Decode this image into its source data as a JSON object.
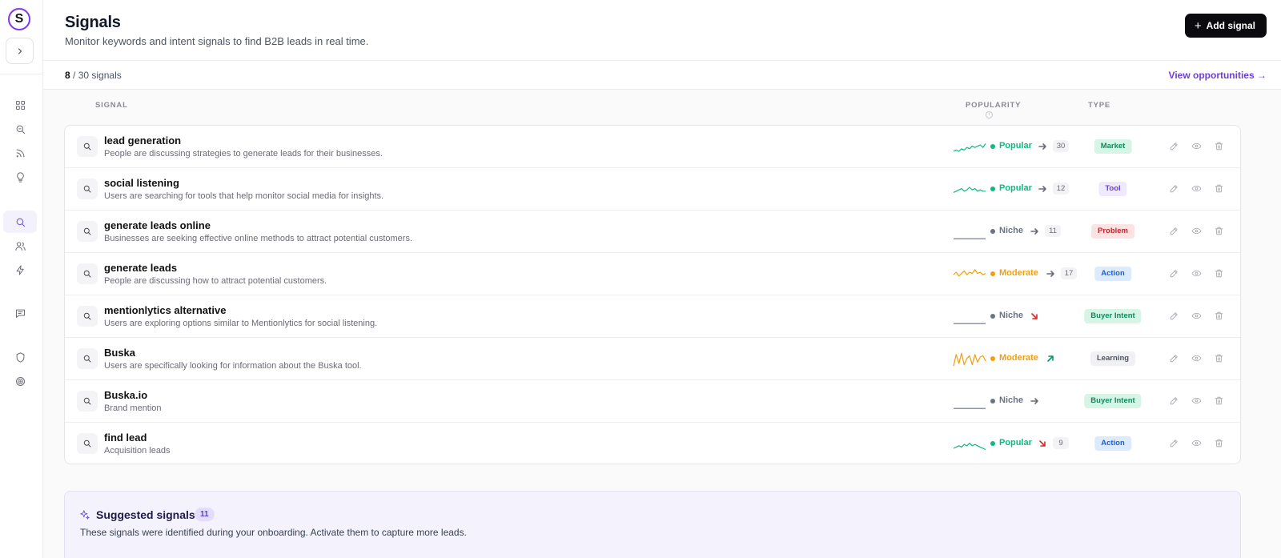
{
  "app": {
    "logo_letter": "S"
  },
  "header": {
    "title": "Signals",
    "subtitle": "Monitor keywords and intent signals to find B2B leads in real time.",
    "add_button": "Add signal"
  },
  "summary": {
    "active": "8",
    "total_text": "/ 30 signals",
    "view_link": "View opportunities →"
  },
  "columns": {
    "signal": "SIGNAL",
    "popularity": "POPULARITY",
    "popularity_info": "i",
    "type": "TYPE"
  },
  "colors": {
    "accent": "#6d3fd6",
    "popular": "#10b981",
    "moderate": "#f59e0b",
    "niche": "#6b7280",
    "trend_down": "#dc2626",
    "trend_up": "#059669"
  },
  "signals": [
    {
      "title": "lead generation",
      "description": "People are discussing strategies to generate leads for their businesses.",
      "popularity": "Popular",
      "trend": "flat",
      "count": "30",
      "type": "Market",
      "spark": [
        10,
        9,
        10,
        8,
        9,
        7,
        8,
        6,
        7,
        6,
        5,
        7,
        4
      ]
    },
    {
      "title": "social listening",
      "description": "Users are searching for tools that help monitor social media for insights.",
      "popularity": "Popular",
      "trend": "flat",
      "count": "12",
      "type": "Tool",
      "spark": [
        9,
        8,
        7,
        6,
        8,
        7,
        5,
        7,
        6,
        8,
        7,
        8,
        8
      ]
    },
    {
      "title": "generate leads online",
      "description": "Businesses are seeking effective online methods to attract potential customers.",
      "popularity": "Niche",
      "trend": "flat",
      "count": "11",
      "type": "Problem",
      "spark": [
        12,
        12,
        12,
        12,
        12,
        12,
        12,
        12,
        12,
        12,
        12,
        12,
        12
      ]
    },
    {
      "title": "generate leads",
      "description": "People are discussing how to attract potential customers.",
      "popularity": "Moderate",
      "trend": "flat",
      "count": "17",
      "type": "Action",
      "spark": [
        7,
        5,
        8,
        6,
        4,
        7,
        5,
        6,
        3,
        6,
        5,
        7,
        6
      ]
    },
    {
      "title": "mentionlytics alternative",
      "description": "Users are exploring options similar to Mentionlytics for social listening.",
      "popularity": "Niche",
      "trend": "down",
      "count": "",
      "type": "Buyer Intent",
      "spark": [
        12,
        12,
        12,
        12,
        12,
        12,
        12,
        12,
        12,
        12,
        12,
        12,
        12
      ]
    },
    {
      "title": "Buska",
      "description": "Users are specifically looking for information about the Buska tool.",
      "popularity": "Moderate",
      "trend": "up",
      "count": "",
      "type": "Learning",
      "spark": [
        12,
        3,
        10,
        2,
        11,
        6,
        4,
        11,
        3,
        9,
        5,
        4,
        8
      ]
    },
    {
      "title": "Buska.io",
      "description": "Brand mention",
      "popularity": "Niche",
      "trend": "flat",
      "count": "",
      "type": "Buyer Intent",
      "spark": [
        12,
        12,
        12,
        12,
        12,
        12,
        12,
        12,
        12,
        12,
        12,
        12,
        12
      ]
    },
    {
      "title": "find lead",
      "description": "Acquisition leads",
      "popularity": "Popular",
      "trend": "down",
      "count": "9",
      "type": "Action",
      "spark": [
        10,
        9,
        8,
        9,
        7,
        8,
        6,
        8,
        7,
        8,
        9,
        10,
        11
      ]
    }
  ],
  "type_styles": {
    "Market": {
      "bg": "#d7f5e6",
      "fg": "#0f8a5f"
    },
    "Tool": {
      "bg": "#efe9fd",
      "fg": "#6d3fd6"
    },
    "Problem": {
      "bg": "#fde2e2",
      "fg": "#c2262f"
    },
    "Action": {
      "bg": "#dceafe",
      "fg": "#1d5fd8"
    },
    "Buyer Intent": {
      "bg": "#d7f5e6",
      "fg": "#0f8a5f"
    },
    "Learning": {
      "bg": "#f1f1f4",
      "fg": "#4b5563"
    }
  },
  "suggested": {
    "title": "Suggested signals",
    "count": "11",
    "description": "These signals were identified during your onboarding. Activate them to capture more leads."
  }
}
